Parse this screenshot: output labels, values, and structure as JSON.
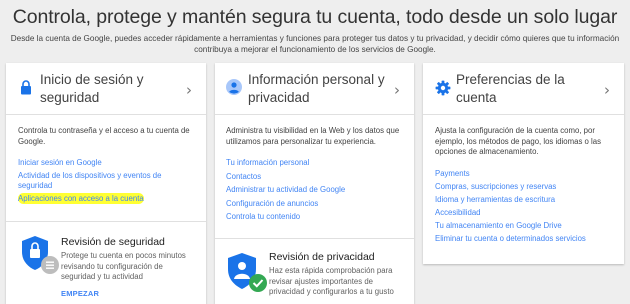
{
  "hero": {
    "title": "Controla, protege y mantén segura tu cuenta, todo desde un solo lugar",
    "subtitle_line1": "Desde la cuenta de Google, puedes acceder rápidamente a herramientas y funciones para proteger tus datos y tu privacidad, y decidir cómo quieres que tu información",
    "subtitle_line2": "contribuya a mejorar el funcionamiento de los servicios de Google."
  },
  "cards": [
    {
      "title_line1": "Inicio de sesión y",
      "title_line2": "seguridad",
      "icon": "lock-icon",
      "description": "Controla tu contraseña y el acceso a tu cuenta de Google.",
      "links": [
        "Iniciar sesión en Google",
        "Actividad de los dispositivos y eventos de",
        "seguridad",
        "Aplicaciones con acceso a la cuenta"
      ],
      "promo": {
        "title": "Revisión de seguridad",
        "text_line1": "Protege tu cuenta en pocos minutos",
        "text_line2": "revisando tu configuración de",
        "text_line3": "seguridad y tu actividad",
        "action": "EMPEZAR"
      }
    },
    {
      "title_line1": "Información personal y",
      "title_line2": "privacidad",
      "icon": "person-icon",
      "description_line1": "Administra tu visibilidad en la Web y los datos que",
      "description_line2": "utilizamos para personalizar tu experiencia.",
      "links": [
        "Tu información personal",
        "Contactos",
        "Administrar tu actividad de Google",
        "Configuración de anuncios",
        "Controla tu contenido"
      ],
      "promo": {
        "title": "Revisión de privacidad",
        "text_line1": "Haz esta rápida comprobación para",
        "text_line2": "revisar ajustes importantes de",
        "text_line3": "privacidad y configurarlos a tu gusto"
      }
    },
    {
      "title_line1": "Preferencias de la",
      "title_line2": "cuenta",
      "icon": "gear-icon",
      "description_line1": "Ajusta la configuración de la cuenta como, por",
      "description_line2": "ejemplo, los métodos de pago, los idiomas o las",
      "description_line3": "opciones de almacenamiento.",
      "links": [
        "Payments",
        "Compras, suscripciones y reservas",
        "Idioma y herramientas de escritura",
        "Accesibilidad",
        "Tu almacenamiento en Google Drive",
        "Eliminar tu cuenta o determinados servicios"
      ]
    }
  ],
  "colors": {
    "link": "#4285f4",
    "lock": "#1a73e8",
    "highlight": "#ffff33",
    "check": "#34a853"
  }
}
